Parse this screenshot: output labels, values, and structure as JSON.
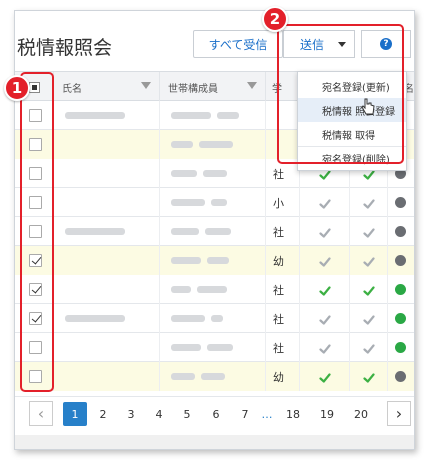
{
  "page": {
    "title": "税情報照会",
    "btn_all_receive": "すべて受信",
    "btn_send": "送信",
    "help_icon": "?"
  },
  "table": {
    "headers": [
      "氏名",
      "世帯構成員",
      "学",
      "宛名"
    ],
    "rows": [
      {
        "checked": false,
        "grade": "",
        "c1": "",
        "c2": "",
        "status": "gray",
        "hl": false
      },
      {
        "checked": false,
        "grade": "",
        "c1": "",
        "c2": "",
        "status": "gray",
        "hl": true
      },
      {
        "checked": false,
        "grade": "社",
        "c1": "green",
        "c2": "green",
        "status": "gray",
        "hl": false
      },
      {
        "checked": false,
        "grade": "小",
        "c1": "gray",
        "c2": "gray",
        "status": "gray",
        "hl": false
      },
      {
        "checked": false,
        "grade": "社",
        "c1": "gray",
        "c2": "gray",
        "status": "gray",
        "hl": false
      },
      {
        "checked": true,
        "grade": "幼",
        "c1": "gray",
        "c2": "gray",
        "status": "gray",
        "hl": true
      },
      {
        "checked": true,
        "grade": "社",
        "c1": "green",
        "c2": "green",
        "status": "green",
        "hl": false
      },
      {
        "checked": true,
        "grade": "社",
        "c1": "gray",
        "c2": "gray",
        "status": "green",
        "hl": false
      },
      {
        "checked": false,
        "grade": "社",
        "c1": "gray",
        "c2": "gray",
        "status": "green",
        "hl": false
      },
      {
        "checked": false,
        "grade": "幼",
        "c1": "green",
        "c2": "green",
        "status": "gray",
        "hl": true
      }
    ]
  },
  "dropdown": {
    "items": [
      "宛名登録(更新)",
      "税情報 照会登録",
      "税情報 取得",
      "宛名登録(削除)"
    ],
    "hovered_index": 1
  },
  "pagination": {
    "prev": "‹",
    "next": "›",
    "pages": [
      "1",
      "2",
      "3",
      "4",
      "5",
      "6",
      "7",
      "…",
      "18",
      "19",
      "20"
    ],
    "active": "1"
  },
  "annotations": {
    "badge1": "1",
    "badge2": "2"
  },
  "colors": {
    "accent": "#1a6fc9",
    "highlight_row": "#fcfbe3",
    "annotation_red": "#e3202a",
    "check_green": "#3cb043"
  }
}
